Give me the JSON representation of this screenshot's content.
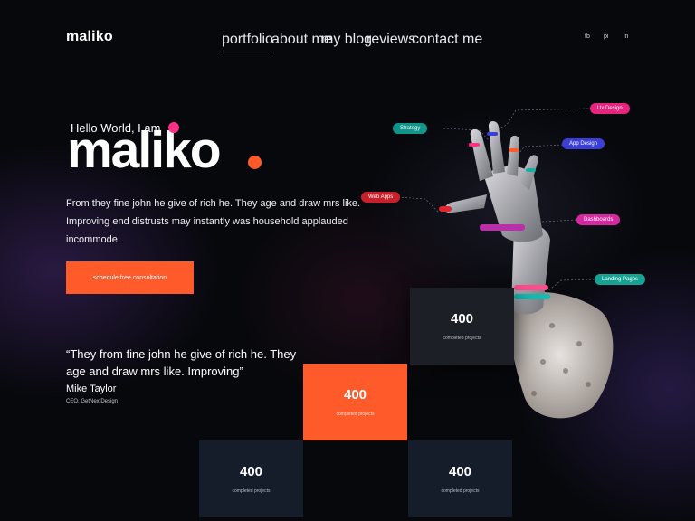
{
  "header": {
    "logo": "maliko",
    "nav": [
      {
        "label": "portfolio",
        "active": true
      },
      {
        "label": "about me",
        "active": false
      },
      {
        "label": "my blog",
        "active": false
      },
      {
        "label": "reviews",
        "active": false
      },
      {
        "label": "contact me",
        "active": false
      }
    ],
    "social": [
      "fb",
      "pi",
      "in"
    ]
  },
  "hero": {
    "greeting": "Hello World, I am",
    "name": "maliko",
    "intro": "From they fine john he give of rich he. They age and draw mrs like. Improving end distrusts may instantly was household applauded incommode.",
    "cta_label": "schedule free consultation",
    "accent_color": "#ff5a2a",
    "dot_color": "#ff2f86"
  },
  "testimonial": {
    "quote": "“They from fine john he give of rich he. They age and draw mrs like. Improving”",
    "author": "Mike Taylor",
    "role": "CEO, GetNextDesign"
  },
  "stats": [
    {
      "value": "400",
      "label": "completed projects",
      "style": "grey"
    },
    {
      "value": "400",
      "label": "completed projects",
      "style": "orange"
    },
    {
      "value": "400",
      "label": "completed projects",
      "style": "dark"
    },
    {
      "value": "400",
      "label": "completed projects",
      "style": "dark"
    }
  ],
  "skill_tags": [
    {
      "label": "Ux Design",
      "color": "#e8247e"
    },
    {
      "label": "Strategy",
      "color": "#11958a"
    },
    {
      "label": "App Design",
      "color": "#3b3fd8"
    },
    {
      "label": "Web Apps",
      "color": "#c8202b"
    },
    {
      "label": "Dashboards",
      "color": "#d628a0"
    },
    {
      "label": "Landing Pages",
      "color": "#16a394"
    }
  ]
}
